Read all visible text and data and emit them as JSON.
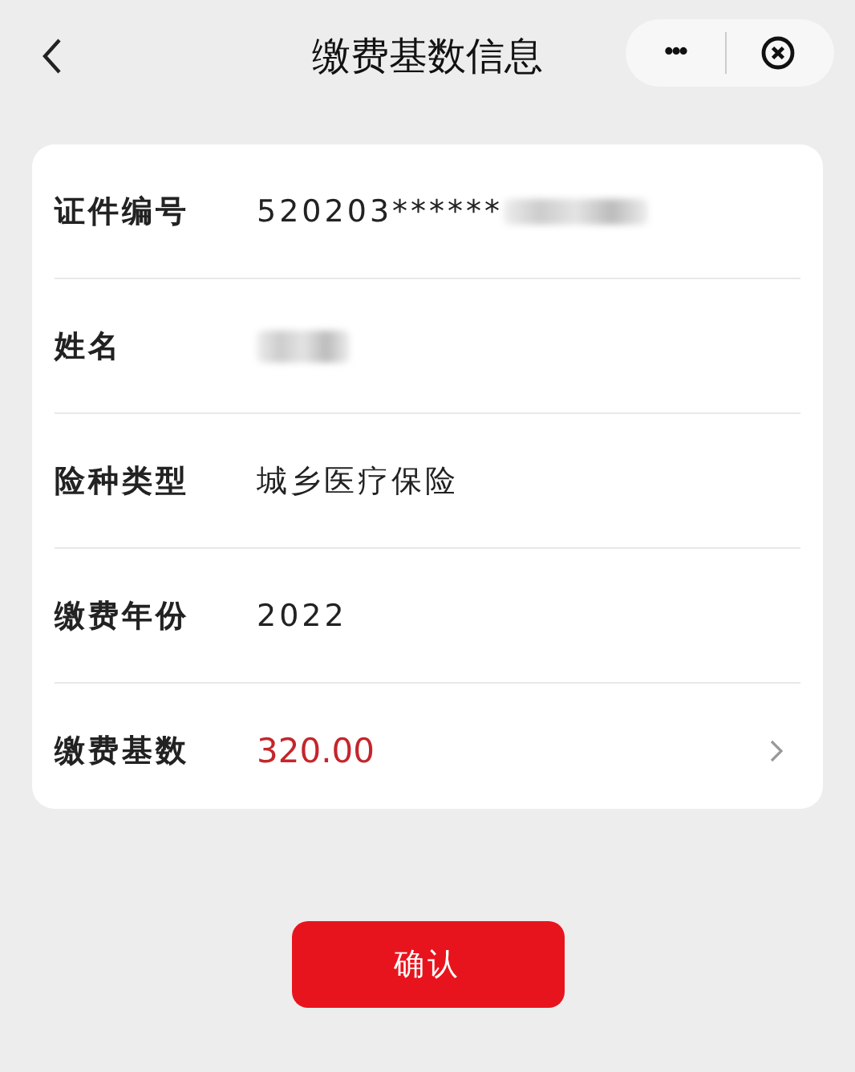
{
  "nav_bar": {
    "title": "缴费基数信息",
    "more_icon": "•••"
  },
  "rows": [
    {
      "kind": "plain",
      "label": "证件编号",
      "value": "520203******",
      "redacted": true
    },
    {
      "kind": "plain",
      "label": "姓名",
      "redacted": true
    },
    {
      "kind": "plain",
      "label": "险种类型",
      "value": "城乡医疗保险"
    },
    {
      "kind": "plain",
      "label": "缴费年份",
      "value": "2022"
    },
    {
      "kind": "link",
      "label": "缴费基数",
      "value": "320.00"
    }
  ],
  "confirm_button": "确认"
}
